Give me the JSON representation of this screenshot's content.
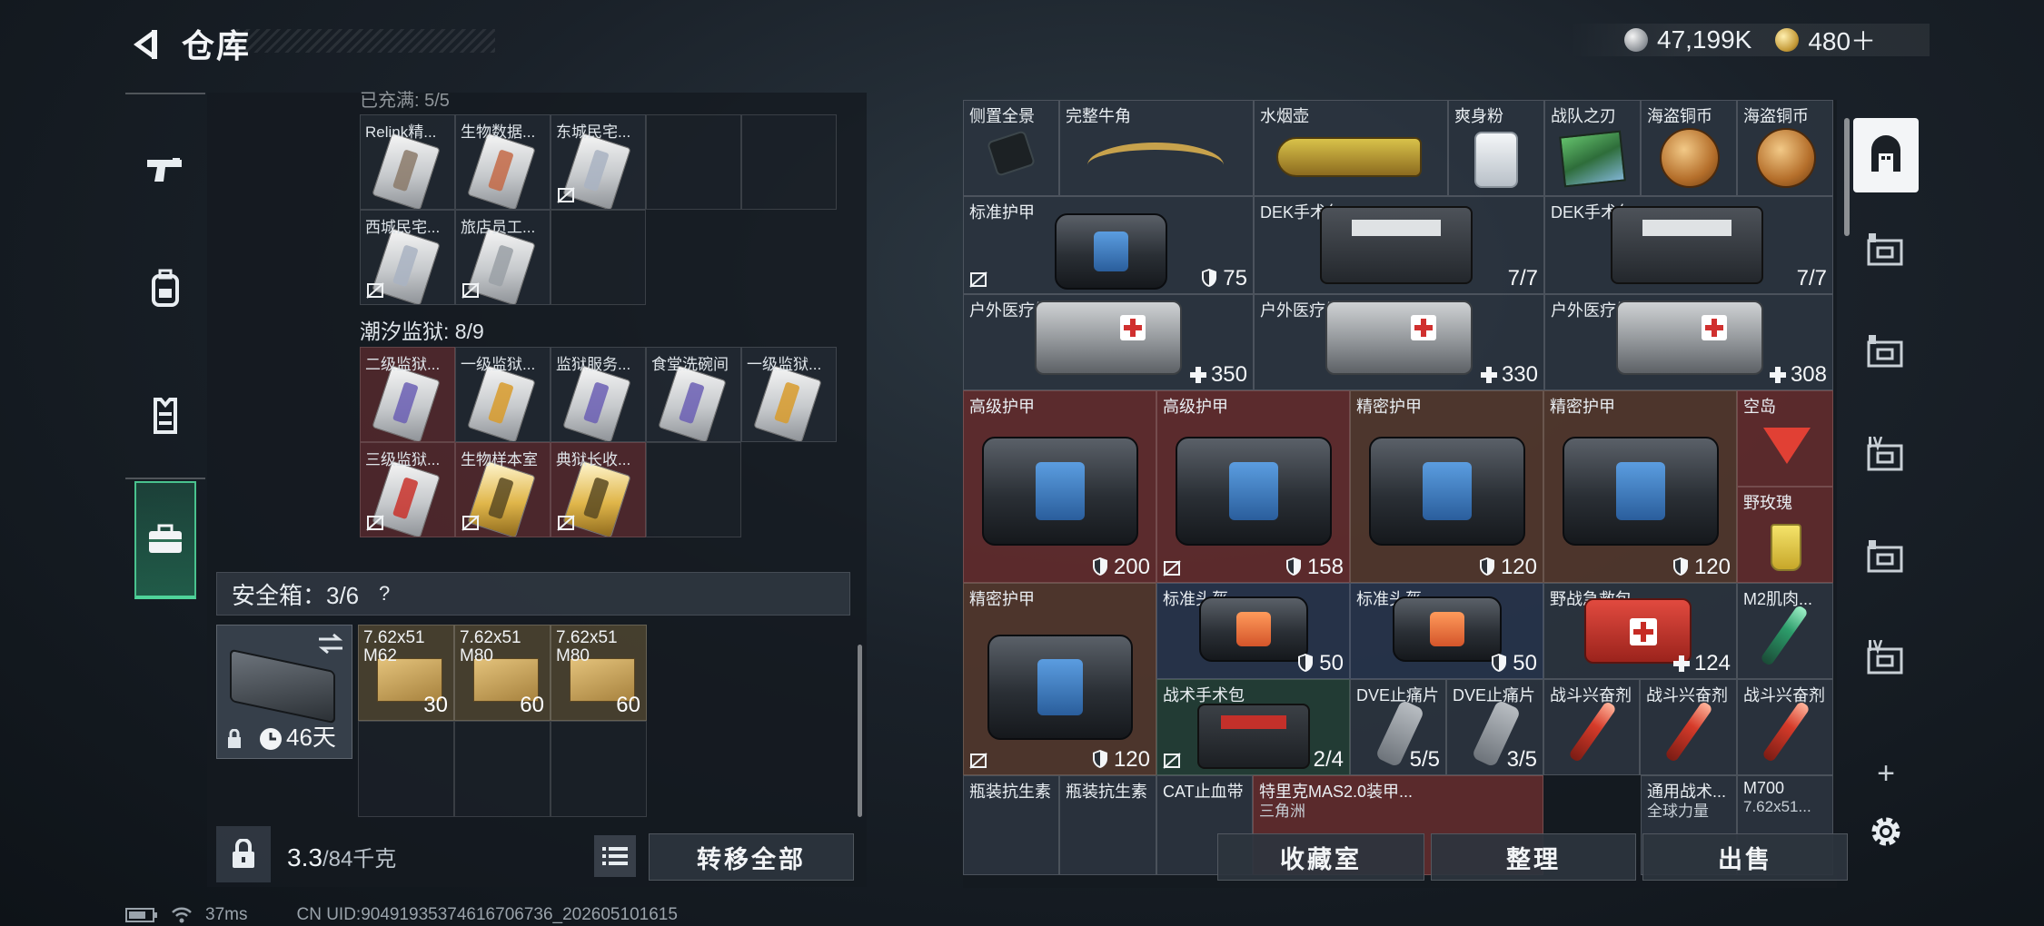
{
  "header": {
    "title": "仓库",
    "currency": [
      {
        "type": "silver",
        "amount": "47,199K"
      },
      {
        "type": "gold",
        "amount": "480＋"
      }
    ]
  },
  "left_tabs": [
    {
      "icon": "pistol-icon",
      "active": false
    },
    {
      "icon": "backpack-icon",
      "active": false
    },
    {
      "icon": "vest-icon",
      "active": false
    },
    {
      "icon": "briefcase-icon",
      "active": true
    }
  ],
  "left_storage": {
    "section_partial": "已充满: 5/5",
    "section_1_items": [
      {
        "name": "Relink精...",
        "stripe": "#8b7a6a",
        "red": false,
        "gold": false,
        "nolock": false
      },
      {
        "name": "生物数据...",
        "stripe": "#c46a47",
        "red": false,
        "gold": false,
        "nolock": false
      },
      {
        "name": "东城民宅...",
        "stripe": "#a9b3c2",
        "red": false,
        "gold": false,
        "nolock": true
      },
      {
        "name": "西城民宅...",
        "stripe": "#a9b3c2",
        "red": false,
        "gold": false,
        "nolock": true
      },
      {
        "name": "旅店员工...",
        "stripe": "#9aa0a6",
        "red": false,
        "gold": false,
        "nolock": true
      }
    ],
    "section_2_label": "潮汐监狱: 8/9",
    "section_2_items": [
      {
        "name": "二级监狱...",
        "stripe": "#6b5fb4",
        "red": true,
        "gold": false,
        "nolock": false
      },
      {
        "name": "一级监狱...",
        "stripe": "#d89b2b",
        "red": false,
        "gold": false,
        "nolock": false
      },
      {
        "name": "监狱服务...",
        "stripe": "#6b5fb4",
        "red": false,
        "gold": false,
        "nolock": false
      },
      {
        "name": "食堂洗碗间",
        "stripe": "#6b5fb4",
        "red": false,
        "gold": false,
        "nolock": false
      },
      {
        "name": "一级监狱...",
        "stripe": "#d89b2b",
        "red": false,
        "gold": false,
        "nolock": false
      },
      {
        "name": "三级监狱...",
        "stripe": "#c9332c",
        "red": true,
        "gold": false,
        "nolock": true
      },
      {
        "name": "生物样本室",
        "stripe": "#5a4a22",
        "red": true,
        "gold": true,
        "nolock": true
      },
      {
        "name": "典狱长收...",
        "stripe": "#5a4a22",
        "red": true,
        "gold": true,
        "nolock": true
      }
    ]
  },
  "safe_box": {
    "label": "安全箱：3/6",
    "help": "?",
    "duration": "46天",
    "items": [
      {
        "name": "7.62x51\nM62",
        "count": "30"
      },
      {
        "name": "7.62x51\nM80",
        "count": "60"
      },
      {
        "name": "7.62x51\nM80",
        "count": "60"
      }
    ]
  },
  "left_footer": {
    "weight_current": "3.3",
    "weight_max": "/84千克",
    "transfer_all": "转移全部"
  },
  "right_storage": {
    "row1": [
      {
        "name": "侧置全景",
        "icon": "scope-icon"
      },
      {
        "name": "完整牛角",
        "icon": "horn-icon"
      },
      {
        "name": "水烟壶",
        "icon": "hookah-icon"
      },
      {
        "name": "爽身粉",
        "icon": "jar-icon"
      },
      {
        "name": "战队之刃",
        "icon": "magazine-icon"
      },
      {
        "name": "海盗铜币",
        "icon": "coin-icon"
      },
      {
        "name": "海盗铜币",
        "icon": "coin-icon"
      }
    ],
    "row2": [
      {
        "name": "标准护甲",
        "value": "75",
        "shield": true,
        "nolock": true
      },
      {
        "name": "DEK手术包",
        "value": "7/7",
        "shield": false,
        "nolock": false
      },
      {
        "name": "DEK手术包",
        "value": "7/7",
        "shield": false,
        "nolock": false
      }
    ],
    "row3": [
      {
        "name": "户外医疗箱",
        "value": "350"
      },
      {
        "name": "户外医疗箱",
        "value": "330"
      },
      {
        "name": "户外医疗箱",
        "value": "308"
      }
    ],
    "row4": [
      {
        "name": "高级护甲",
        "value": "200",
        "nolock": false
      },
      {
        "name": "高级护甲",
        "value": "158",
        "nolock": true
      },
      {
        "name": "精密护甲",
        "value": "120",
        "nolock": false
      },
      {
        "name": "精密护甲",
        "value": "120",
        "nolock": false
      }
    ],
    "drinks": [
      {
        "name": "空岛"
      },
      {
        "name": "野玫瑰"
      }
    ],
    "row5_big": {
      "name": "精密护甲",
      "value": "120"
    },
    "row5_helmets": [
      {
        "name": "标准头盔",
        "value": "50"
      },
      {
        "name": "标准头盔",
        "value": "50"
      }
    ],
    "row5_medkit": {
      "name": "野战急救包",
      "value": "124"
    },
    "row5_m2": {
      "name": "M2肌肉..."
    },
    "row6": [
      {
        "name": "战术手术包",
        "value": "2/4"
      },
      {
        "name": "DVE止痛片",
        "value": "5/5"
      },
      {
        "name": "DVE止痛片",
        "value": "3/5"
      },
      {
        "name": "战斗兴奋剂"
      },
      {
        "name": "战斗兴奋剂"
      },
      {
        "name": "战斗兴奋剂"
      }
    ],
    "row7": [
      {
        "name": "瓶装抗生素",
        "sub": ""
      },
      {
        "name": "瓶装抗生素",
        "sub": ""
      },
      {
        "name": "CAT止血带",
        "sub": ""
      },
      {
        "name": "特里克MAS2.0装甲...",
        "sub": "三角洲"
      },
      {
        "name": "通用战术...",
        "sub": "全球力量"
      },
      {
        "name": "M700",
        "sub": "7.62x51..."
      }
    ]
  },
  "right_footer": {
    "collection": "收藏室",
    "organize": "整理",
    "sell": "出售"
  },
  "right_bar": {
    "add": "+",
    "settings_icon": "gear-icon"
  },
  "status": {
    "ping": "37ms",
    "uid": "CN UID:904919353746167067​36_202605101615"
  }
}
